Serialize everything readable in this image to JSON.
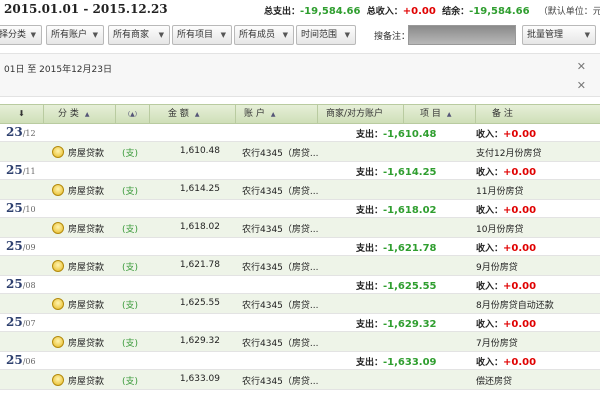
{
  "header": {
    "daterange": "2015.01.01 - 2015.12.23",
    "expense_label": "总支出：",
    "expense_value": "-19,584.66",
    "income_label": "总收入：",
    "income_value": "+0.00",
    "balance_label": "结余：",
    "balance_value": "-19,584.66",
    "unit": "（默认单位：元）"
  },
  "toolbar": {
    "btn_category": "择分类",
    "btn_account": "所有账户",
    "btn_merchant": "所有商家",
    "btn_project": "所有项目",
    "btn_member": "所有成员",
    "btn_timerange": "时间范围",
    "search_label": "搜备注：",
    "search_value": "",
    "btn_batch": "批量管理"
  },
  "filter": {
    "text": "01日 至 2015年12月23日"
  },
  "table": {
    "headers": {
      "category": "分 类",
      "amount": "金 额",
      "account": "账 户",
      "merchant": "商家/对方账户",
      "project": "项 目",
      "note": "备 注"
    }
  },
  "groups": [
    {
      "day": "23",
      "month": "/12",
      "expense_label": "支出：",
      "expense": "-1,610.48",
      "income_label": "收入：",
      "income": "+0.00",
      "category": "房屋贷款",
      "type": "(支)",
      "amount": "1,610.48",
      "account": "农行4345（房贷...",
      "note": "支付12月份房贷"
    },
    {
      "day": "25",
      "month": "/11",
      "expense_label": "支出：",
      "expense": "-1,614.25",
      "income_label": "收入：",
      "income": "+0.00",
      "category": "房屋贷款",
      "type": "(支)",
      "amount": "1,614.25",
      "account": "农行4345（房贷...",
      "note": "11月份房贷"
    },
    {
      "day": "25",
      "month": "/10",
      "expense_label": "支出：",
      "expense": "-1,618.02",
      "income_label": "收入：",
      "income": "+0.00",
      "category": "房屋贷款",
      "type": "(支)",
      "amount": "1,618.02",
      "account": "农行4345（房贷...",
      "note": "10月份房贷"
    },
    {
      "day": "25",
      "month": "/09",
      "expense_label": "支出：",
      "expense": "-1,621.78",
      "income_label": "收入：",
      "income": "+0.00",
      "category": "房屋贷款",
      "type": "(支)",
      "amount": "1,621.78",
      "account": "农行4345（房贷...",
      "note": "9月份房贷"
    },
    {
      "day": "25",
      "month": "/08",
      "expense_label": "支出：",
      "expense": "-1,625.55",
      "income_label": "收入：",
      "income": "+0.00",
      "category": "房屋贷款",
      "type": "(支)",
      "amount": "1,625.55",
      "account": "农行4345（房贷...",
      "note": "8月份房贷自动还款"
    },
    {
      "day": "25",
      "month": "/07",
      "expense_label": "支出：",
      "expense": "-1,629.32",
      "income_label": "收入：",
      "income": "+0.00",
      "category": "房屋贷款",
      "type": "(支)",
      "amount": "1,629.32",
      "account": "农行4345（房贷...",
      "note": "7月份房贷"
    },
    {
      "day": "25",
      "month": "/06",
      "expense_label": "支出：",
      "expense": "-1,633.09",
      "income_label": "收入：",
      "income": "+0.00",
      "category": "房屋贷款",
      "type": "(支)",
      "amount": "1,633.09",
      "account": "农行4345（房贷...",
      "note": "偿还房贷"
    }
  ]
}
